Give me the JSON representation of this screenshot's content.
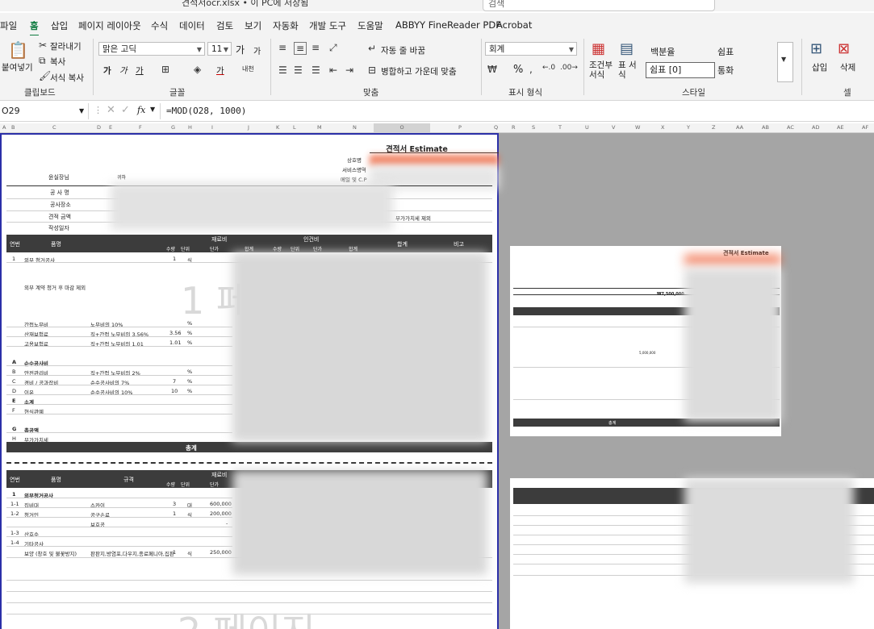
{
  "window": {
    "title": "견적서ocr.xlsx • 이 PC에 저장됨",
    "search_placeholder": "검색"
  },
  "menu": {
    "tabs": [
      "파일",
      "홈",
      "삽입",
      "페이지 레이아웃",
      "수식",
      "데이터",
      "검토",
      "보기",
      "자동화",
      "개발 도구",
      "도움말",
      "ABBYY FineReader PDF",
      "Acrobat"
    ],
    "active": "홈"
  },
  "ribbon": {
    "clipboard": {
      "paste": "붙여넣기",
      "cut": "잘라내기",
      "copy": "복사",
      "format_painter": "서식 복사",
      "label": "클립보드"
    },
    "font": {
      "name": "맑은 고딕",
      "size": "11",
      "grow": "가",
      "shrink": "가",
      "bold": "가",
      "italic": "가",
      "underline": "가",
      "phonetic": "내천",
      "font_color": "가",
      "label": "글꼴"
    },
    "alignment": {
      "wrap": "자동 줄 바꿈",
      "merge": "병합하고 가운데 맞춤",
      "label": "맞춤"
    },
    "number": {
      "format": "회계",
      "percent": "%",
      "label": "표시 형식"
    },
    "styles": {
      "conditional": "조건부 서식",
      "table": "표 서식",
      "cells": [
        "백분율",
        "쉼표",
        "쉼표 [0]",
        "통화"
      ],
      "label": "스타일"
    },
    "cells": {
      "insert": "삽입",
      "delete": "삭제",
      "label": "셀"
    }
  },
  "formula_bar": {
    "name_box": "O29",
    "fx": "fx",
    "formula": "=MOD(O28, 1000)"
  },
  "columns": [
    "A",
    "B",
    "C",
    "D",
    "E",
    "F",
    "G",
    "H",
    "I",
    "J",
    "K",
    "L",
    "M",
    "N",
    "O",
    "P",
    "Q",
    "R",
    "S",
    "T",
    "U",
    "V",
    "W",
    "X",
    "Y",
    "Z",
    "AA",
    "AB",
    "AC",
    "AD",
    "AE",
    "AF"
  ],
  "sheet": {
    "title": "견적서 Estimate",
    "company_fields": [
      "상호명",
      "서비스명역",
      "메일 및 C.P"
    ],
    "recipient": "윤실장님",
    "honorific": "귀하",
    "info_labels": [
      "공 사 명",
      "공사장소",
      "견적 금액",
      "작성일자"
    ],
    "vat_note": "부가가치세 제외",
    "table1_header": [
      "연번",
      "품명",
      "재료비",
      "인건비",
      "합계",
      "비고"
    ],
    "sub_header": [
      "수량",
      "단위",
      "단가",
      "합계",
      "수량",
      "단위",
      "단가",
      "합계"
    ],
    "rows": [
      {
        "no": "1",
        "name": "외부 청거공사",
        "spec": "",
        "qty": "1",
        "unit": "식"
      },
      {
        "no": "",
        "name": "외부 계약 청거 후 마감 제외",
        "spec": "",
        "qty": "",
        "unit": ""
      },
      {
        "no": "",
        "name": "간접노무비",
        "spec": "노무비의 10%",
        "qty": "",
        "unit": "%"
      },
      {
        "no": "",
        "name": "산재보험료",
        "spec": "직+간접 노무비의 3.56%",
        "qty": "3.56",
        "unit": "%"
      },
      {
        "no": "",
        "name": "고용보험료",
        "spec": "직+간접 노무비의 1.01",
        "qty": "1.01",
        "unit": "%"
      },
      {
        "no": "A",
        "name": "순수공사비",
        "spec": "",
        "qty": "",
        "unit": ""
      },
      {
        "no": "B",
        "name": "안전관리비",
        "spec": "직+간접 노무비의 2%",
        "qty": "",
        "unit": "%"
      },
      {
        "no": "C",
        "name": "경비 / 공과잡비",
        "spec": "순수공사비의 7%",
        "qty": "7",
        "unit": "%"
      },
      {
        "no": "D",
        "name": "이윤",
        "spec": "순수공사비의 10%",
        "qty": "10",
        "unit": "%"
      },
      {
        "no": "E",
        "name": "소계",
        "spec": "",
        "qty": "",
        "unit": ""
      },
      {
        "no": "F",
        "name": "현식관예",
        "spec": "",
        "qty": "",
        "unit": ""
      },
      {
        "no": "G",
        "name": "총공액",
        "spec": "",
        "qty": "",
        "unit": ""
      },
      {
        "no": "H",
        "name": "부가가치세",
        "spec": "",
        "qty": "",
        "unit": ""
      }
    ],
    "total_label": "총계",
    "page1_watermark": "1 페이지",
    "page2_watermark": "2 페이지",
    "table2_header": [
      "연번",
      "품명",
      "규격",
      "재료비"
    ],
    "table2_rows": [
      {
        "no": "1",
        "name": "외부청거공사",
        "spec": "",
        "qty": "",
        "unit": "",
        "price": ""
      },
      {
        "no": "1-1",
        "name": "집비대",
        "spec": "스카이",
        "qty": "3",
        "unit": "대",
        "price": "600,000"
      },
      {
        "no": "1-2",
        "name": "청거인",
        "spec": "공구손료",
        "qty": "1",
        "unit": "식",
        "price": "200,000"
      },
      {
        "no": "",
        "name": "",
        "spec": "보호공",
        "qty": "",
        "unit": "",
        "price": "-"
      },
      {
        "no": "1-3",
        "name": "산호수",
        "spec": "",
        "qty": "",
        "unit": "",
        "price": ""
      },
      {
        "no": "1-4",
        "name": "기타공사",
        "spec": "",
        "qty": "",
        "unit": "",
        "price": ""
      },
      {
        "no": "",
        "name": "보양 (창호 및 불꽃방지)",
        "spec": "판판지,방염포,다우지,종료페니아,집판",
        "qty": "1",
        "unit": "식",
        "price": "250,000"
      }
    ],
    "mini_title": "견적서 Estimate",
    "mini_amount": "₩7,500,000",
    "mini_total": "총계",
    "mini_subtotal": "5,000,000"
  }
}
